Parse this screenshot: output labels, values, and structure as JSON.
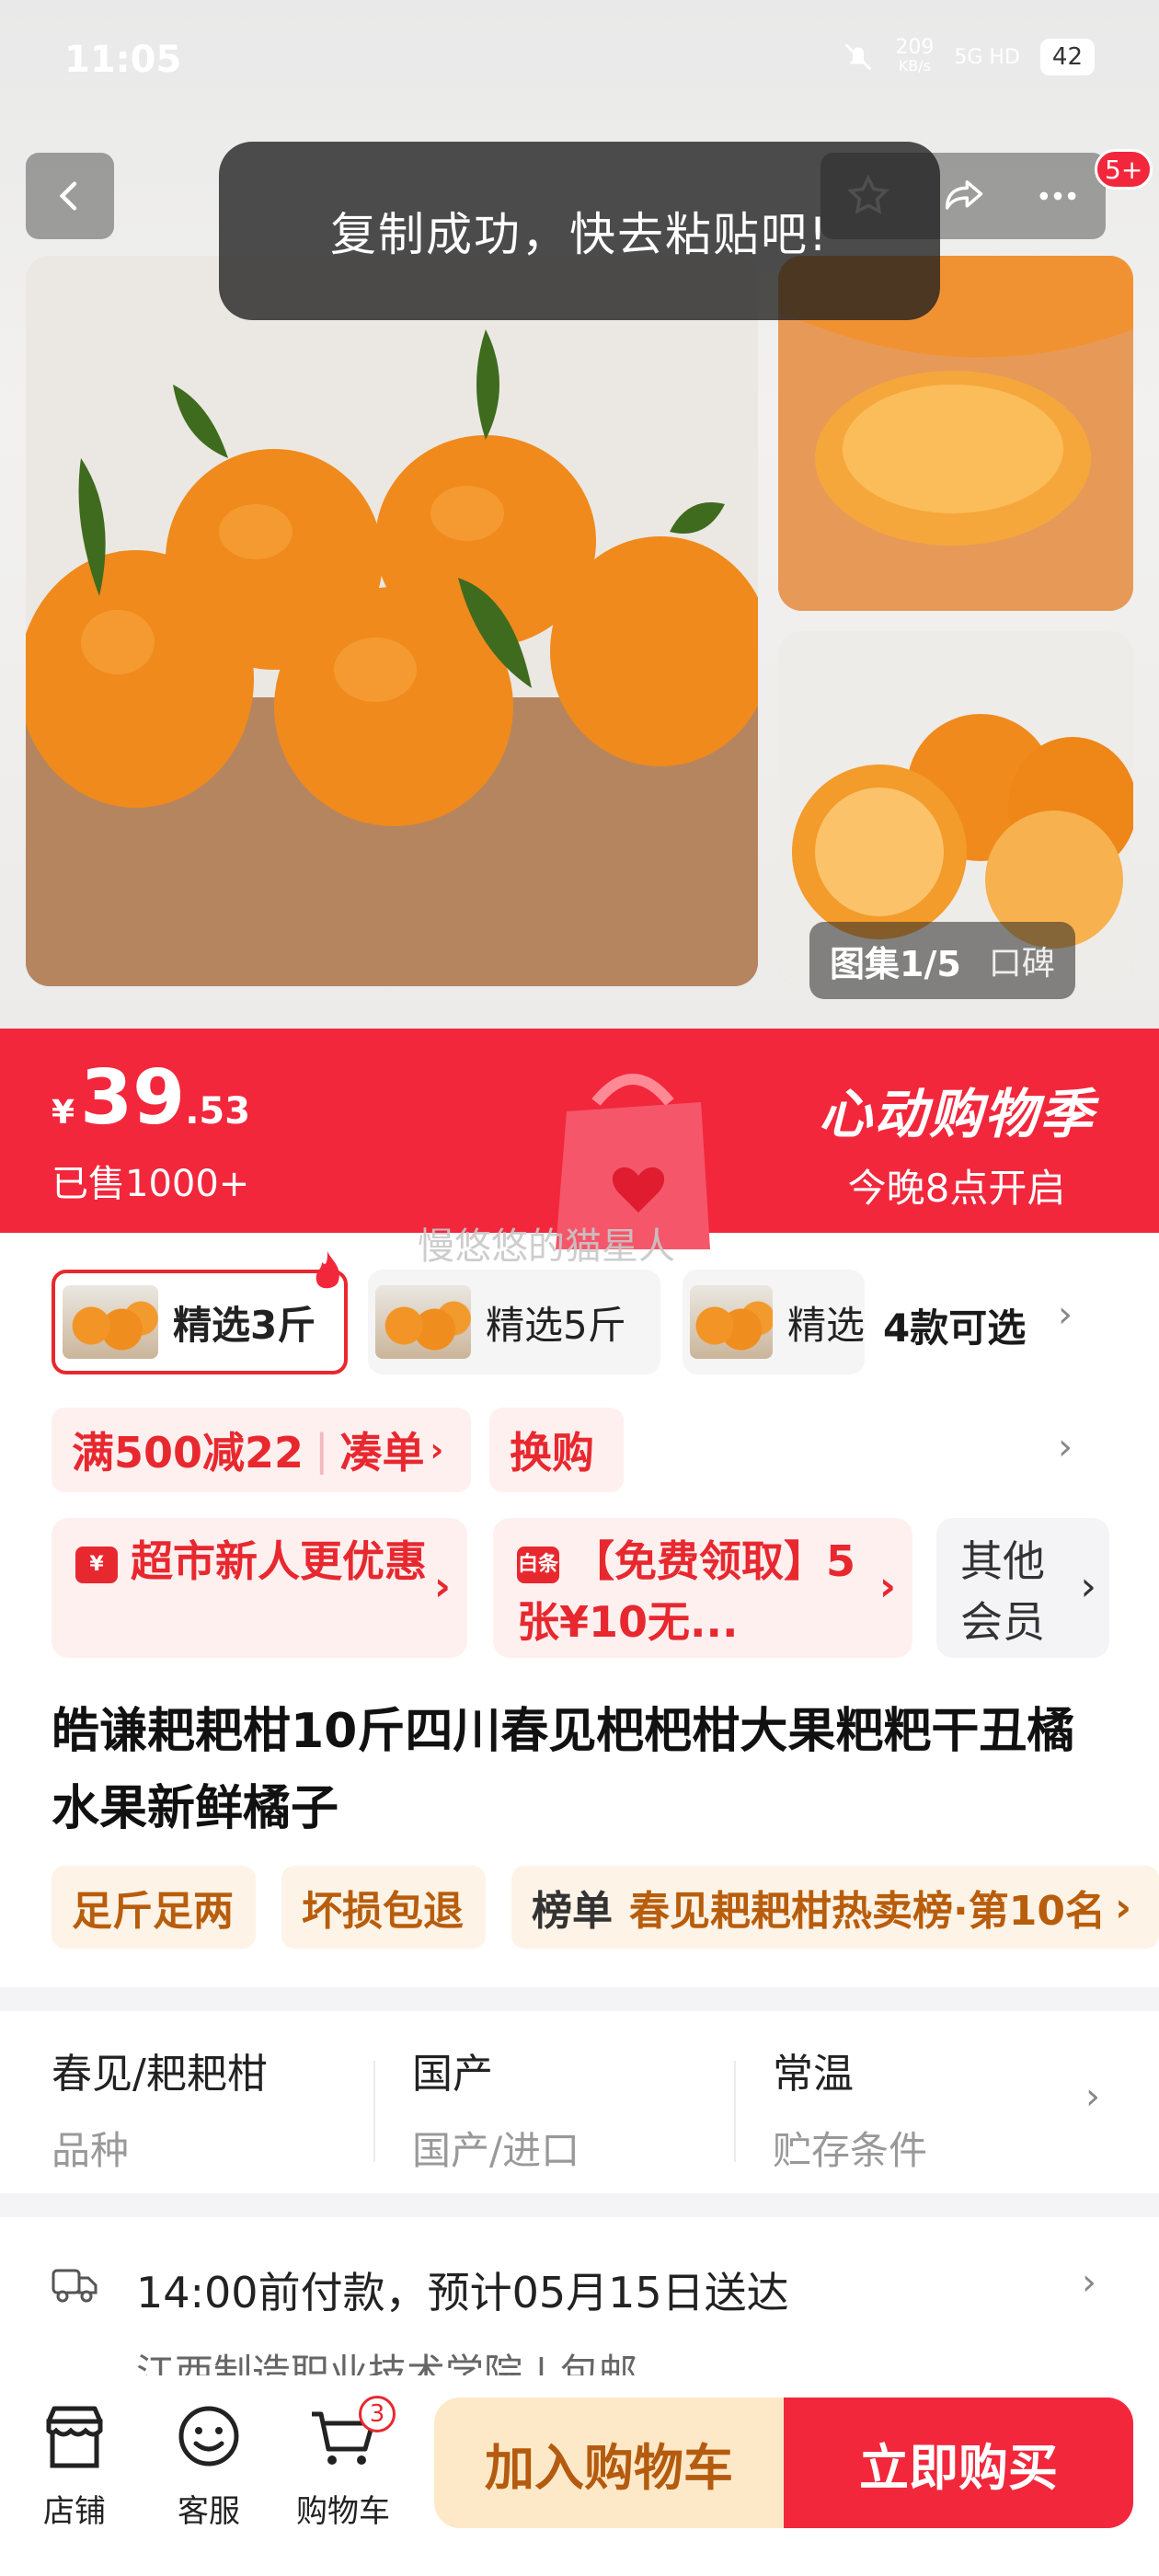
{
  "status_bar": {
    "time": "11:05",
    "net_speed": "209",
    "net_unit": "KB/s",
    "network": "5G HD",
    "battery": "42"
  },
  "header": {
    "badge": "5+"
  },
  "toast": "复制成功，快去粘贴吧!",
  "gallery": {
    "album_label": "图集1/5",
    "review_label": "口碑"
  },
  "price_banner": {
    "currency": "¥",
    "price_int": "39",
    "price_dec": ".53",
    "sold": "已售1000+",
    "event_title": "心动购物季",
    "event_sub": "今晚8点开启"
  },
  "watermark": "慢悠悠的猫星人",
  "sku": {
    "options": [
      "精选3斤",
      "精选5斤",
      "精选"
    ],
    "count_label": "4款可选"
  },
  "promotions": {
    "discount": "满500减22",
    "gather": "凑单",
    "exchange": "换购",
    "coupon1": "超市新人更优惠",
    "coupon2_icon": "白条",
    "coupon2": "【免费领取】5张¥10无...",
    "coupon3": "其他会员"
  },
  "title": "皓谦耙耙柑10斤四川春见杷杷柑大果粑粑干丑橘水果新鲜橘子",
  "tags": {
    "t1": "足斤足两",
    "t2": "坏损包退",
    "rank_head": "榜单",
    "rank": "春见耙耙柑热卖榜·第10名"
  },
  "attributes": [
    {
      "value": "春见/耙耙柑",
      "key": "品种"
    },
    {
      "value": "国产",
      "key": "国产/进口"
    },
    {
      "value": "常温",
      "key": "贮存条件"
    }
  ],
  "delivery": {
    "line1": "14:00前付款，预计05月15日送达",
    "line2": "江西制造职业技术学院 | 包邮"
  },
  "bottom_bar": {
    "shop": "店铺",
    "service": "客服",
    "cart": "购物车",
    "cart_count": "3",
    "add_to_cart": "加入购物车",
    "buy_now": "立即购买"
  },
  "colors": {
    "brand_red": "#f2273c",
    "tag_orange": "#b85d0c",
    "cart_bg": "#fde9c8"
  }
}
